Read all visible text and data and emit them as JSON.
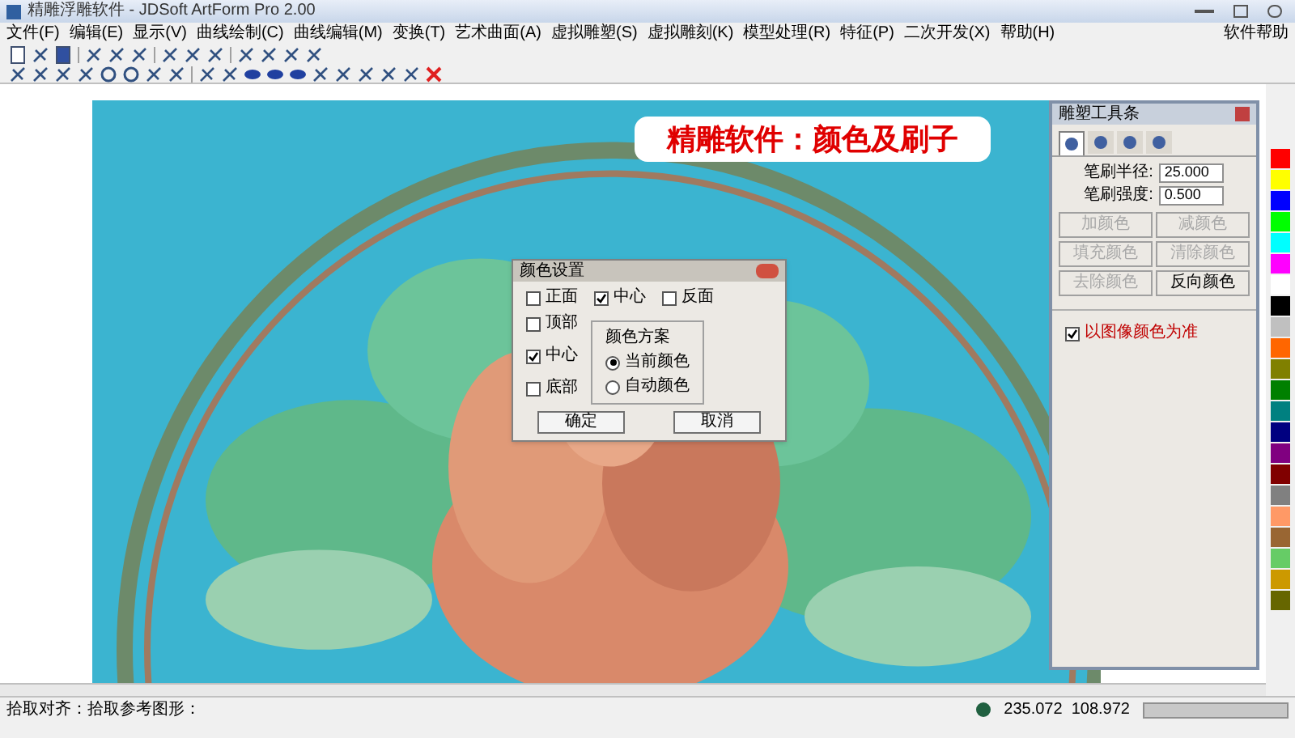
{
  "window": {
    "title": "精雕浮雕软件 - JDSoft ArtForm Pro 2.00"
  },
  "menu": [
    "文件(F)",
    "编辑(E)",
    "显示(V)",
    "曲线绘制(C)",
    "曲线编辑(M)",
    "变换(T)",
    "艺术曲面(A)",
    "虚拟雕塑(S)",
    "虚拟雕刻(K)",
    "模型处理(R)",
    "特征(P)",
    "二次开发(X)",
    "帮助(H)"
  ],
  "menu_right": "软件帮助",
  "banner": "精雕软件：颜色及刷子",
  "dialog": {
    "title": "颜色设置",
    "top_options": [
      {
        "label": "正面",
        "checked": false
      },
      {
        "label": "中心",
        "checked": true
      },
      {
        "label": "反面",
        "checked": false
      }
    ],
    "left_options": [
      {
        "label": "顶部",
        "checked": false
      },
      {
        "label": "中心",
        "checked": true
      },
      {
        "label": "底部",
        "checked": false
      }
    ],
    "group": {
      "title": "颜色方案",
      "options": [
        {
          "label": "当前颜色",
          "selected": true
        },
        {
          "label": "自动颜色",
          "selected": false
        }
      ]
    },
    "buttons": [
      "确定",
      "取消"
    ]
  },
  "panel": {
    "title": "雕塑工具条",
    "tabs": [
      {
        "selected": true
      },
      {
        "selected": false
      },
      {
        "selected": false
      },
      {
        "selected": false
      }
    ],
    "fields": [
      {
        "label": "笔刷半径:",
        "value": "25.000"
      },
      {
        "label": "笔刷强度:",
        "value": "0.500"
      }
    ],
    "buttons": [
      {
        "label": "加颜色",
        "disabled": true
      },
      {
        "label": "减颜色",
        "disabled": true
      },
      {
        "label": "填充颜色",
        "disabled": true
      },
      {
        "label": "清除颜色",
        "disabled": true
      },
      {
        "label": "去除颜色",
        "disabled": true
      },
      {
        "label": "反向颜色",
        "disabled": false
      }
    ],
    "checkbox": {
      "label": "以图像颜色为准",
      "checked": true
    }
  },
  "palette": [
    {
      "color": "#ff0000"
    },
    {
      "color": "#ffff00"
    },
    {
      "color": "#0000ff"
    },
    {
      "color": "#00ff00"
    },
    {
      "color": "#00ffff"
    },
    {
      "color": "#ff00ff"
    },
    {
      "color": "#ffffff"
    },
    {
      "color": "#000000"
    },
    {
      "color": "#c0c0c0"
    },
    {
      "color": "#ff6600"
    },
    {
      "color": "#808000"
    },
    {
      "color": "#008000"
    },
    {
      "color": "#008080"
    },
    {
      "color": "#000080"
    },
    {
      "color": "#800080"
    },
    {
      "color": "#800000"
    },
    {
      "color": "#808080"
    },
    {
      "color": "#ff9966"
    },
    {
      "color": "#996633"
    },
    {
      "color": "#66cc66"
    },
    {
      "color": "#cc9900"
    },
    {
      "color": "#666600"
    }
  ],
  "status": {
    "text": "拾取对齐：拾取参考图形：",
    "coords": "235.072  108.972"
  }
}
